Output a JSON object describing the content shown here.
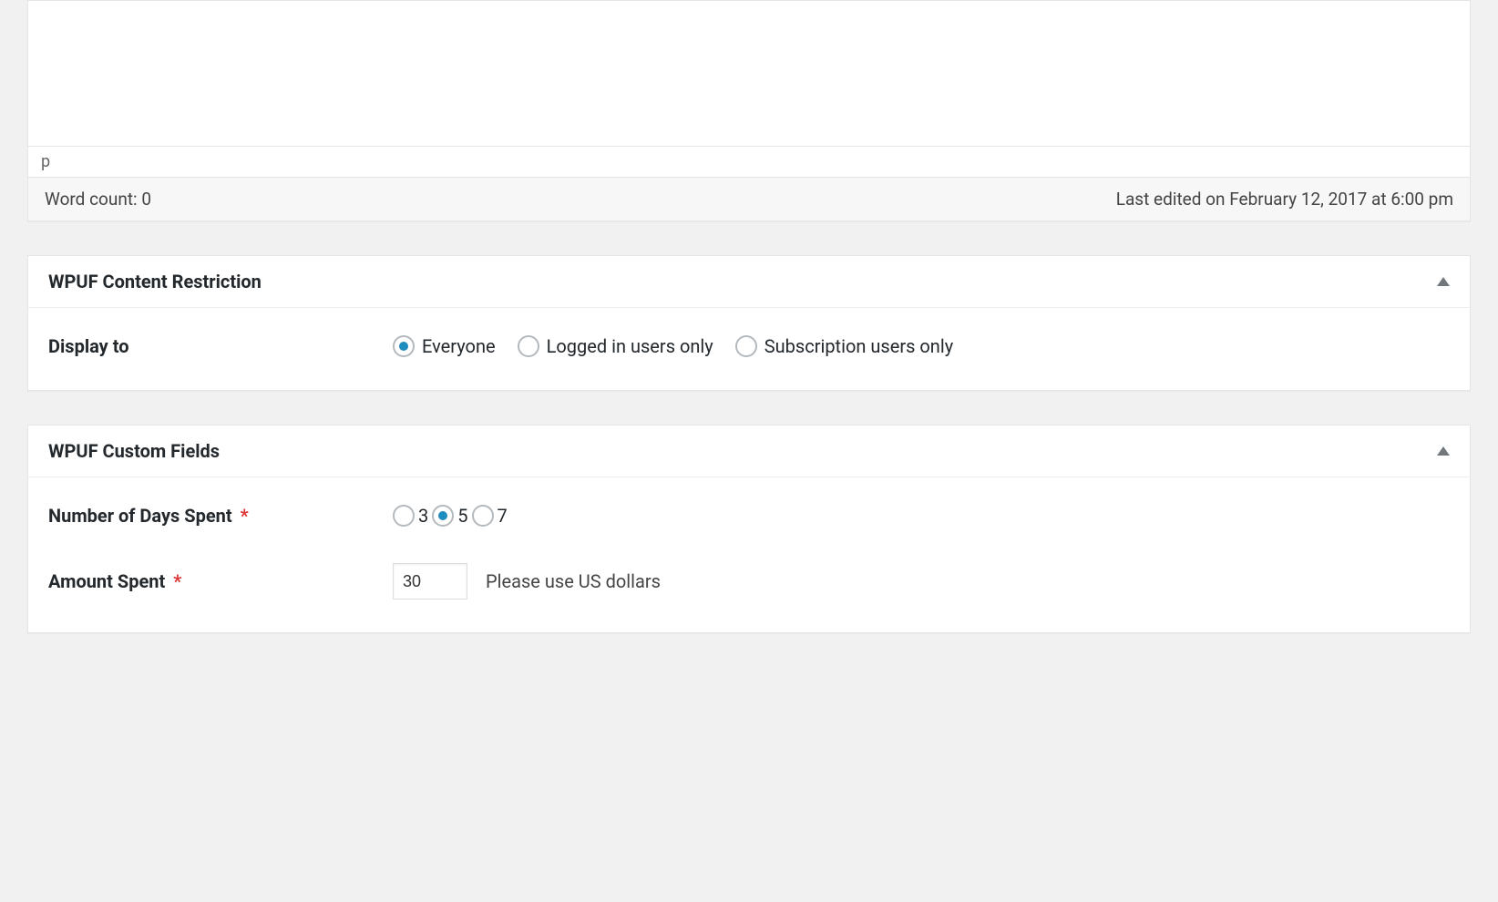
{
  "editor": {
    "path_display": "p",
    "word_count_label": "Word count: 0",
    "last_edited_label": "Last edited on February 12, 2017 at 6:00 pm"
  },
  "content_restriction_panel": {
    "title": "WPUF Content Restriction",
    "display_to_label": "Display to",
    "options": {
      "everyone": "Everyone",
      "logged_in": "Logged in users only",
      "subscription": "Subscription users only"
    },
    "selected": "everyone"
  },
  "custom_fields_panel": {
    "title": "WPUF Custom Fields",
    "days_spent": {
      "label": "Number of Days Spent",
      "required_mark": "*",
      "options": {
        "opt1": "3",
        "opt2": "5",
        "opt3": "7"
      },
      "selected": "opt2"
    },
    "amount_spent": {
      "label": "Amount Spent",
      "required_mark": "*",
      "value": "30",
      "help_text": "Please use US dollars"
    }
  }
}
